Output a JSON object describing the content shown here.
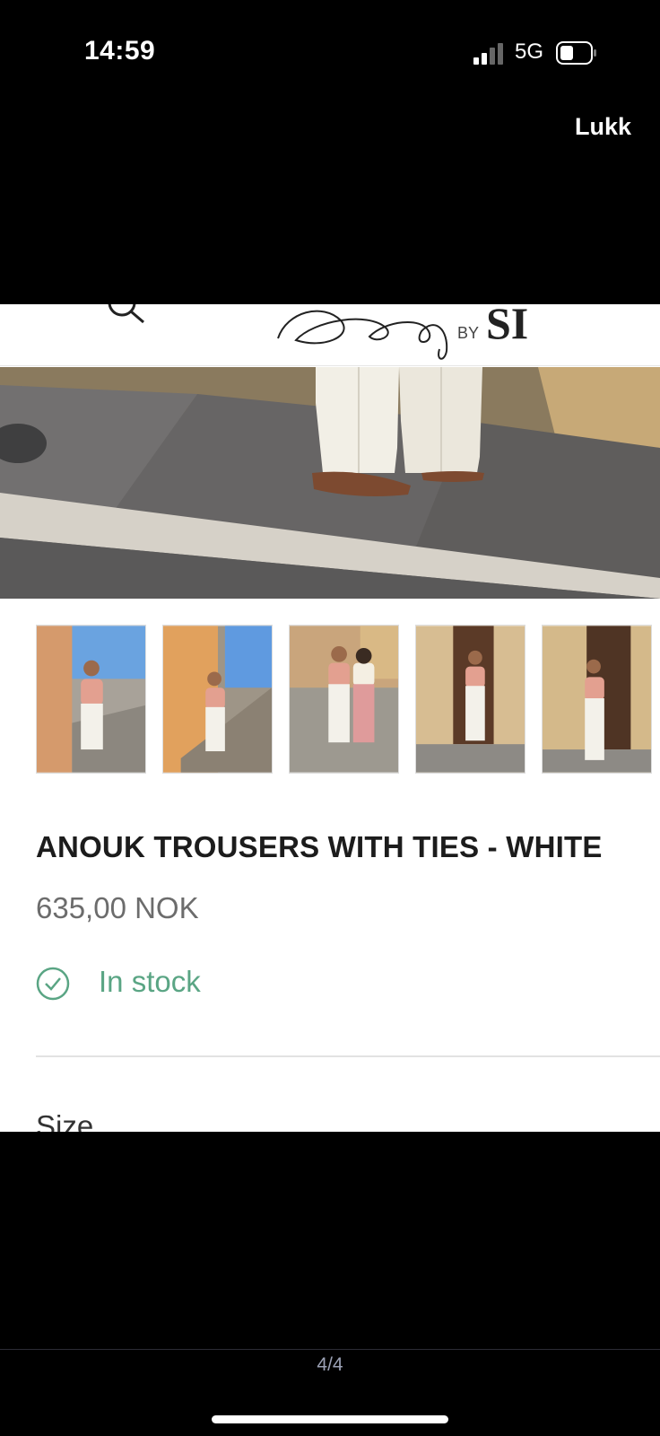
{
  "status": {
    "time": "14:59",
    "network": "5G"
  },
  "viewer": {
    "close_label": "Lukk",
    "page_counter": "4/4"
  },
  "site": {
    "logo_by": "BY",
    "logo_initials": "SI"
  },
  "product": {
    "title": "ANOUK TROUSERS WITH TIES - WHITE",
    "price": "635,00 NOK",
    "stock": "In stock",
    "size_label": "Size"
  }
}
